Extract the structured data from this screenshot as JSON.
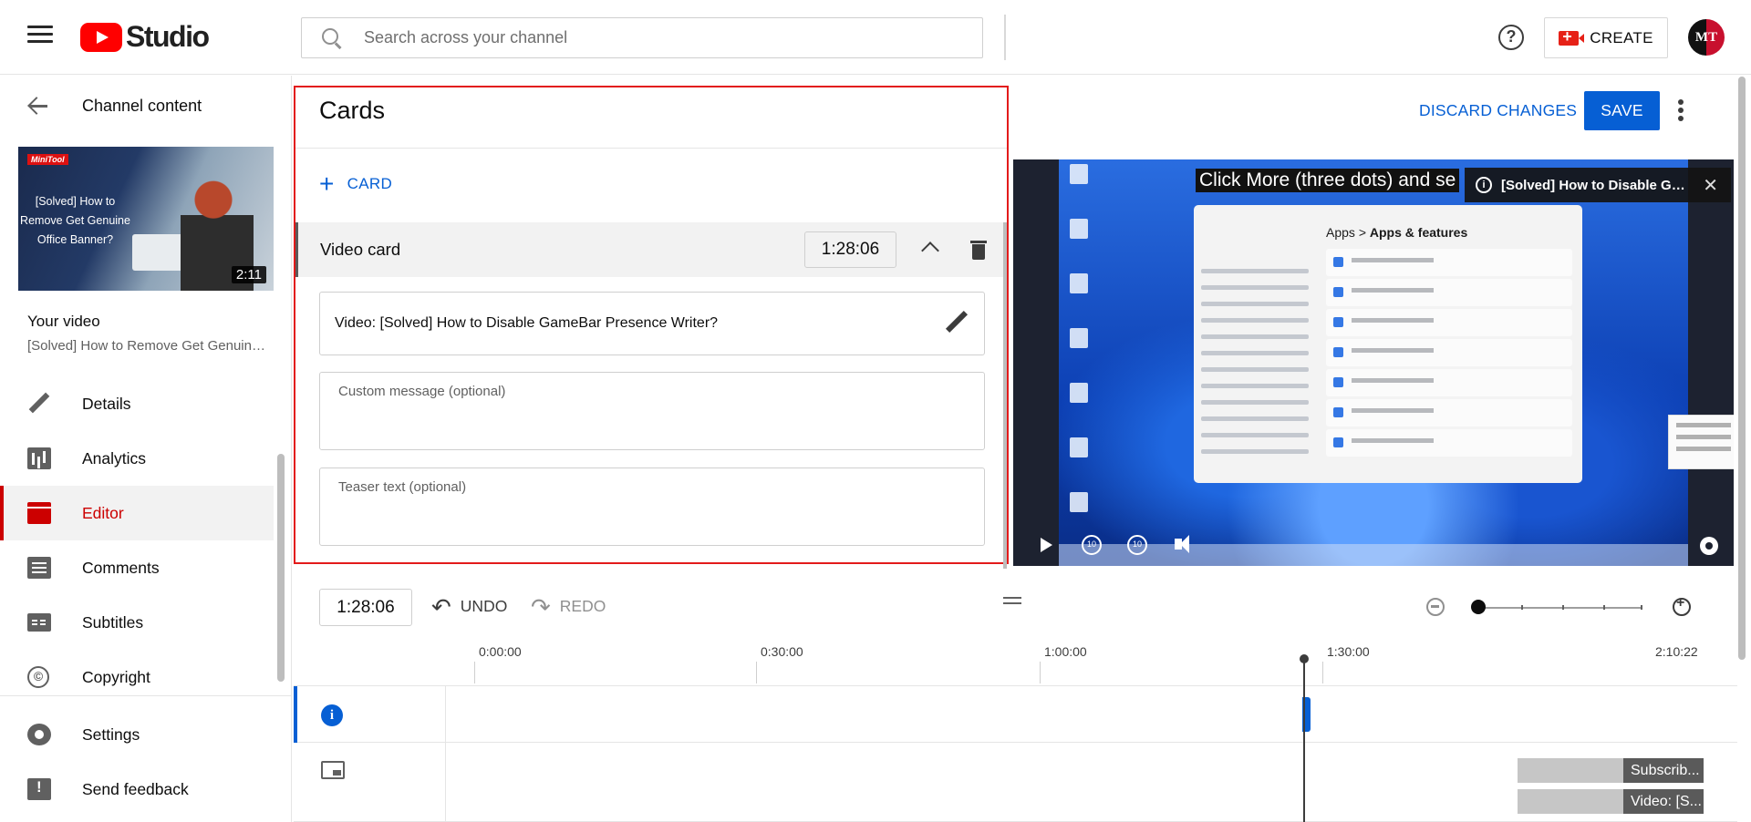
{
  "header": {
    "brand": "Studio",
    "search_placeholder": "Search across your channel",
    "help_glyph": "?",
    "create_label": "CREATE",
    "avatar_initials": "MT"
  },
  "sidebar": {
    "back_title": "Channel content",
    "thumbnail": {
      "brand_badge": "MiniTool",
      "text": "[Solved] How to Remove Get Genuine Office Banner?",
      "duration": "2:11"
    },
    "your_video_label": "Your video",
    "video_title": "[Solved] How to Remove Get Genuine Office Banner?",
    "items": [
      {
        "label": "Details",
        "icon": "pencil-icon"
      },
      {
        "label": "Analytics",
        "icon": "analytics-icon"
      },
      {
        "label": "Editor",
        "icon": "editor-icon"
      },
      {
        "label": "Comments",
        "icon": "comments-icon"
      },
      {
        "label": "Subtitles",
        "icon": "subtitles-icon"
      },
      {
        "label": "Copyright",
        "icon": "copyright-icon"
      }
    ],
    "bottom_items": [
      {
        "label": "Settings",
        "icon": "gear-icon"
      },
      {
        "label": "Send feedback",
        "icon": "feedback-icon"
      }
    ]
  },
  "cards": {
    "title": "Cards",
    "add_label": "CARD",
    "video_card": {
      "label": "Video card",
      "time": "1:28:06",
      "video_text": "Video: [Solved] How to Disable GameBar Presence Writer?",
      "custom_message_placeholder": "Custom message (optional)",
      "teaser_placeholder": "Teaser text (optional)"
    }
  },
  "actions": {
    "discard_label": "DISCARD CHANGES",
    "save_label": "SAVE"
  },
  "player": {
    "overlay_title": "Click More (three dots) and se",
    "settings_breadcrumb_parent": "Apps",
    "settings_breadcrumb_sep": ">",
    "settings_breadcrumb_current": "Apps & features",
    "card_teaser": "[Solved] How to Disable GameBar Presence Writer?",
    "card_teaser_close": "✕",
    "rewind_label": "10",
    "forward_label": "10"
  },
  "timeline": {
    "current_time": "1:28:06",
    "undo_label": "UNDO",
    "redo_label": "REDO",
    "ruler": [
      "0:00:00",
      "0:30:00",
      "1:00:00",
      "1:30:00",
      "2:10:22"
    ],
    "zoom_level": 0,
    "end_screen_elements": [
      "Subscrib...",
      "Video: [S..."
    ]
  },
  "colors": {
    "accent_blue": "#065fd4",
    "brand_red": "#ff0000",
    "active_red": "#cc0000",
    "highlight_border": "#e31b1b"
  }
}
